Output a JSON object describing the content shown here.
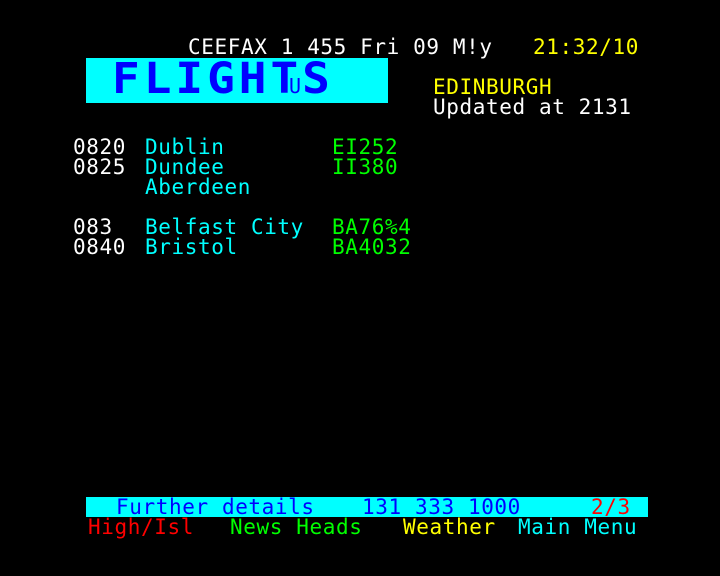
{
  "header": {
    "service": "CEEFAX 1 455 Fri 09 M!y",
    "time": "21:32/10"
  },
  "logo": {
    "title": "FLIGHTS",
    "overlay_char": "U"
  },
  "airport": {
    "name": "EDINBURGH",
    "updated": "Updated at 2131"
  },
  "flights": [
    {
      "time": "0820",
      "destination": "Dublin",
      "flight": "EI252"
    },
    {
      "time": "0825",
      "destination": "Dundee",
      "flight": "II380"
    },
    {
      "time": "",
      "destination": "Aberdeen",
      "flight": ""
    },
    {
      "time": "083",
      "destination": "Belfast City",
      "flight": "BA76%4"
    },
    {
      "time": "0840",
      "destination": "Bristol",
      "flight": "BA4032"
    }
  ],
  "footer": {
    "info_label": "Further details",
    "info_phone": "131 333 1000",
    "page_count": "2/3"
  },
  "fastext": {
    "red": "High/Isl",
    "green": "News Heads",
    "yellow": "Weather",
    "cyan": "Main Menu"
  },
  "colors": {
    "background": "#000000",
    "header_text": "#ffffff",
    "clock": "#ffff00",
    "logo_bg": "#00ffff",
    "logo_fg": "#0000ff",
    "destination": "#00ffff",
    "flight_number": "#00ff00",
    "time": "#ffffff"
  }
}
